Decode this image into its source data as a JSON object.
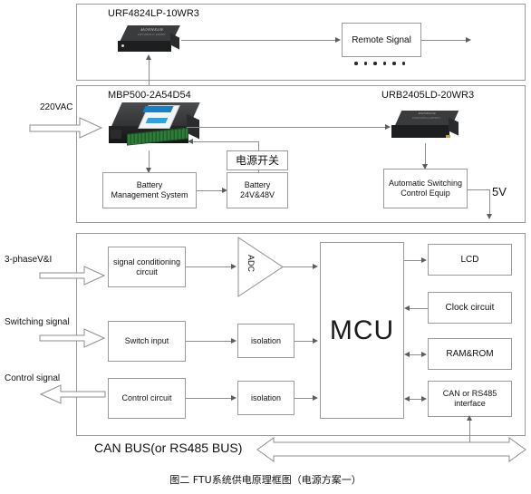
{
  "figure": {
    "caption": "图二 FTU系统供电原理框图（电源方案一）"
  },
  "panel_top": {
    "module_label": "URF4824LP-10WR3",
    "module_brand": "MORNSUN",
    "module_part": "URF4824LP-10WR3",
    "remote_signal_box": "Remote Signal",
    "ellipsis_dots": 6
  },
  "panel_mid": {
    "left_module_label": "MBP500-2A54D54",
    "right_module_label": "URB2405LD-20WR3",
    "input_label": "220VAC",
    "power_switch_box": "电源开关",
    "bms_box": "Battery\nManagement System",
    "bms_line1": "Battery",
    "bms_line2": "Management System",
    "battery_box_line1": "Battery",
    "battery_box_line2": "24V&48V",
    "auto_switch_line1": "Automatic Switching",
    "auto_switch_line2": "Control  Equip",
    "output_label": "5V"
  },
  "panel_bottom": {
    "inputs": [
      {
        "label": "3-phaseV&I",
        "direction": "in"
      },
      {
        "label": "Switching signal",
        "direction": "in"
      },
      {
        "label": "Control signal",
        "direction": "out"
      }
    ],
    "signal_conditioning_line1": "signal conditioning",
    "signal_conditioning_line2": "circuit",
    "adc_label": "ADC",
    "switch_input_box": "Switch input",
    "control_circuit_box": "Control circuit",
    "isolation_box_1": "isolation",
    "isolation_box_2": "isolation",
    "mcu_box": "MCU",
    "peripherals": [
      {
        "label": "LCD",
        "line2": ""
      },
      {
        "label": "Clock circuit",
        "line2": ""
      },
      {
        "label": "RAM&ROM",
        "line2": ""
      },
      {
        "label": "CAN or RS485",
        "line2": "interface"
      }
    ]
  },
  "bus": {
    "label": "CAN BUS(or RS485 BUS)"
  },
  "colors": {
    "line": "#8d8d8d",
    "border": "#9a9a9a",
    "text": "#111111",
    "module_body": "#1d1e20",
    "module_top": "#3a3b3d",
    "terminal_green": "#2f7d3a",
    "label_blue": "#1b7fc4"
  }
}
